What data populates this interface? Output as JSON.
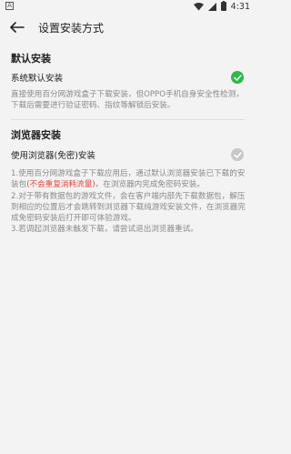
{
  "status_bar": {
    "left_icon": "notification-a-icon",
    "time": "4:31"
  },
  "header": {
    "back_icon": "back-arrow-icon",
    "title": "设置安装方式"
  },
  "default_section": {
    "title": "默认安装",
    "option_label": "系统默认安装",
    "selected": true,
    "description": "直接使用百分网游戏盒子下载安装，但OPPO手机自身安全性检测，下载后需要进行验证密码、指纹等解锁后安装。"
  },
  "browser_section": {
    "title": "浏览器安装",
    "option_label": "使用浏览器(免密)安装",
    "selected": false,
    "desc_line1_before": "1.使用百分网游戏盒子下载应用后，通过默认浏览器安装已下载的安装包",
    "desc_line1_warn": "(不会重复消耗流量)",
    "desc_line1_after": "，在浏览器内完成免密码安装。",
    "desc_line2": "2.对于带有数据包的游戏文件，会在客户端内部先下载数据包，解压到相应的位置后才会跳转到浏览器下载纯游戏安装文件，在浏览器完成免密码安装后打开即可体验游戏。",
    "desc_line3": "3.若调起浏览器未触发下载，请尝试退出浏览器重试。"
  },
  "colors": {
    "accent_green": "#2db84b",
    "warning_red": "#e8453c",
    "muted_text": "#8a8a8a",
    "background": "#f3f3f3"
  }
}
